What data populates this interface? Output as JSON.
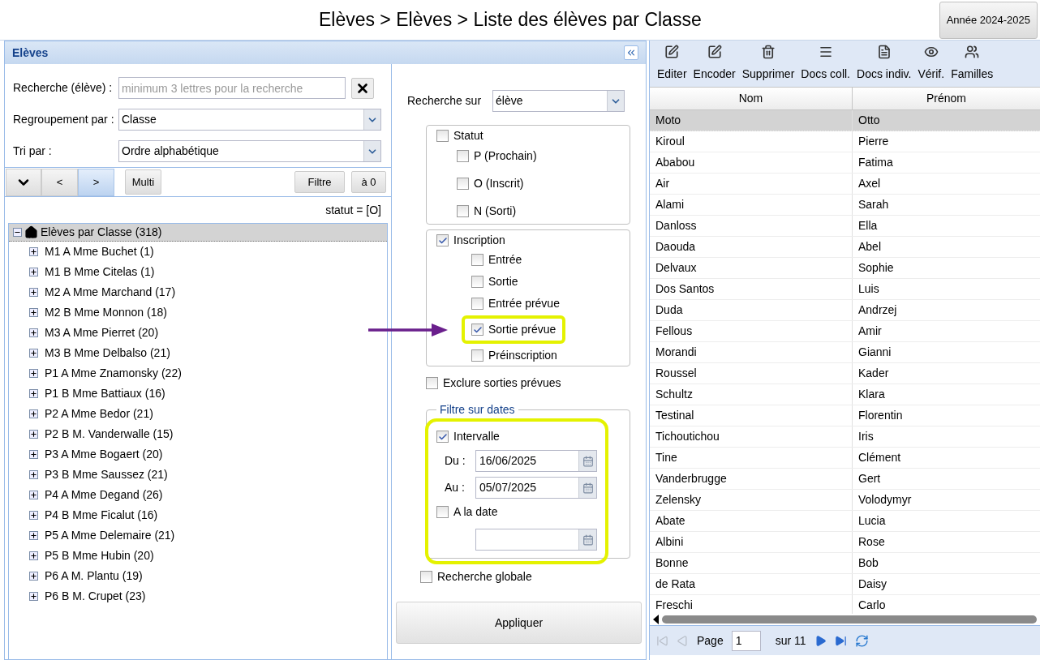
{
  "header": {
    "title": "Elèves > Elèves > Liste des élèves par Classe",
    "year_button": "Année 2024-2025"
  },
  "panel": {
    "title": "Elèves"
  },
  "search": {
    "label": "Recherche (élève) :",
    "placeholder": "minimum 3 lettres pour la recherche"
  },
  "grouping": {
    "label": "Regroupement par :",
    "value": "Classe"
  },
  "sort": {
    "label": "Tri par :",
    "value": "Ordre alphabétique"
  },
  "nav_buttons": [
    {
      "label": "<",
      "selected": false
    },
    {
      "label": ">",
      "selected": true
    }
  ],
  "multi_button": "Multi",
  "filter_button": "Filtre",
  "reset_button": "à 0",
  "filter_summary": "statut = [O]",
  "tree": {
    "label": "Elèves par Classe (318)",
    "selected": true,
    "expanded": true,
    "children": [
      {
        "label": "M1 A Mme Buchet (1)",
        "expanded": false
      },
      {
        "label": "M1 B Mme Citelas (1)",
        "expanded": false
      },
      {
        "label": "M2 A Mme Marchand (17)",
        "expanded": false
      },
      {
        "label": "M2 B Mme Monnon (18)",
        "expanded": false
      },
      {
        "label": "M3 A Mme Pierret (20)",
        "expanded": false
      },
      {
        "label": "M3 B Mme Delbalso (21)",
        "expanded": false
      },
      {
        "label": "P1 A Mme Znamonsky (22)",
        "expanded": false
      },
      {
        "label": "P1 B Mme Battiaux (16)",
        "expanded": false
      },
      {
        "label": "P2 A Mme Bedor (21)",
        "expanded": false
      },
      {
        "label": "P2 B M. Vanderwalle (15)",
        "expanded": false
      },
      {
        "label": "P3 A Mme Bogaert (20)",
        "expanded": false
      },
      {
        "label": "P3 B Mme Saussez (21)",
        "expanded": false
      },
      {
        "label": "P4 A Mme Degand (26)",
        "expanded": false
      },
      {
        "label": "P4 B Mme Ficalut (16)",
        "expanded": false
      },
      {
        "label": "P5 A Mme Delemaire (21)",
        "expanded": false
      },
      {
        "label": "P5 B Mme Hubin (20)",
        "expanded": false
      },
      {
        "label": "P6 A M. Plantu (19)",
        "expanded": false
      },
      {
        "label": "P6 B M. Crupet (23)",
        "expanded": false
      }
    ]
  },
  "search_on": {
    "label": "Recherche sur",
    "value": "élève"
  },
  "statut": {
    "label": "Statut",
    "checked": false,
    "options": [
      {
        "label": "P (Prochain)",
        "checked": false
      },
      {
        "label": "O (Inscrit)",
        "checked": false
      },
      {
        "label": "N (Sorti)",
        "checked": false
      }
    ]
  },
  "inscription": {
    "label": "Inscription",
    "checked": true,
    "options": [
      {
        "label": "Entrée",
        "checked": false,
        "highlighted": false
      },
      {
        "label": "Sortie",
        "checked": false,
        "highlighted": false
      },
      {
        "label": "Entrée prévue",
        "checked": false,
        "highlighted": false
      },
      {
        "label": "Sortie prévue",
        "checked": true,
        "highlighted": true
      },
      {
        "label": "Préinscription",
        "checked": false,
        "highlighted": false
      }
    ]
  },
  "exclude": {
    "label": "Exclure sorties prévues",
    "checked": false
  },
  "date_filter": {
    "legend": "Filtre sur dates",
    "highlighted": true,
    "interval": {
      "label": "Intervalle",
      "checked": true
    },
    "from": {
      "label": "Du :",
      "value": "16/06/2025"
    },
    "to": {
      "label": "Au :",
      "value": "05/07/2025"
    },
    "on_date": {
      "label": "A la date",
      "checked": false
    }
  },
  "global_search": {
    "label": "Recherche globale",
    "checked": false
  },
  "apply_button": "Appliquer",
  "toolbar": [
    {
      "kind": "edit",
      "label": "Editer"
    },
    {
      "kind": "edit",
      "label": "Encoder"
    },
    {
      "kind": "delete",
      "label": "Supprimer"
    },
    {
      "kind": "list",
      "label": "Docs coll."
    },
    {
      "kind": "doc",
      "label": "Docs indiv."
    },
    {
      "kind": "view",
      "label": "Vérif."
    },
    {
      "kind": "family",
      "label": "Familles"
    }
  ],
  "table": {
    "columns": [
      "Nom",
      "Prénom"
    ],
    "rows": [
      {
        "cells": [
          "Moto",
          "Otto"
        ],
        "selected": true
      },
      {
        "cells": [
          "Kiroul",
          "Pierre"
        ],
        "selected": false
      },
      {
        "cells": [
          "Ababou",
          "Fatima"
        ],
        "selected": false
      },
      {
        "cells": [
          "Air",
          "Axel"
        ],
        "selected": false
      },
      {
        "cells": [
          "Alami",
          "Sarah"
        ],
        "selected": false
      },
      {
        "cells": [
          "Danloss",
          "Ella"
        ],
        "selected": false
      },
      {
        "cells": [
          "Daouda",
          "Abel"
        ],
        "selected": false
      },
      {
        "cells": [
          "Delvaux",
          "Sophie"
        ],
        "selected": false
      },
      {
        "cells": [
          "Dos Santos",
          "Luis"
        ],
        "selected": false
      },
      {
        "cells": [
          "Duda",
          "Andrzej"
        ],
        "selected": false
      },
      {
        "cells": [
          "Fellous",
          "Amir"
        ],
        "selected": false
      },
      {
        "cells": [
          "Morandi",
          "Gianni"
        ],
        "selected": false
      },
      {
        "cells": [
          "Roussel",
          "Kader"
        ],
        "selected": false
      },
      {
        "cells": [
          "Schultz",
          "Klara"
        ],
        "selected": false
      },
      {
        "cells": [
          "Testinal",
          "Florentin"
        ],
        "selected": false
      },
      {
        "cells": [
          "Tichoutichou",
          "Iris"
        ],
        "selected": false
      },
      {
        "cells": [
          "Tine",
          "Clément"
        ],
        "selected": false
      },
      {
        "cells": [
          "Vanderbrugge",
          "Gert"
        ],
        "selected": false
      },
      {
        "cells": [
          "Zelensky",
          "Volodymyr"
        ],
        "selected": false
      },
      {
        "cells": [
          "Abate",
          "Lucia"
        ],
        "selected": false
      },
      {
        "cells": [
          "Albini",
          "Rose"
        ],
        "selected": false
      },
      {
        "cells": [
          "Bonne",
          "Bob"
        ],
        "selected": false
      },
      {
        "cells": [
          "de Rata",
          "Daisy"
        ],
        "selected": false
      },
      {
        "cells": [
          "Freschi",
          "Carlo"
        ],
        "selected": false
      }
    ]
  },
  "pager": {
    "label": "Page",
    "value": "1",
    "total": "sur 11",
    "first_disabled": true,
    "prev_disabled": true
  }
}
